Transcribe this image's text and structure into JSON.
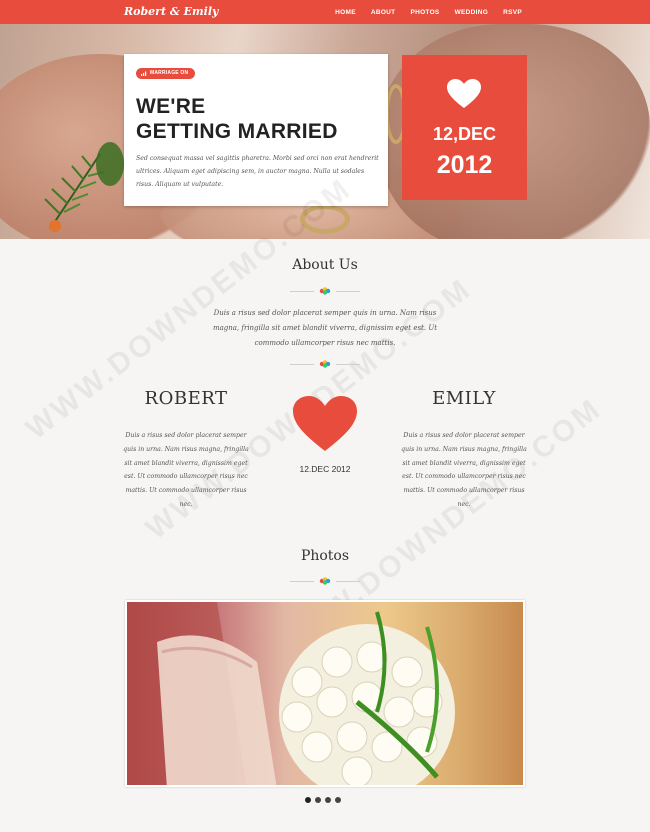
{
  "nav": {
    "brand": "Robert & Emily",
    "links": [
      "HOME",
      "ABOUT",
      "PHOTOS",
      "WEDDING",
      "RSVP"
    ]
  },
  "hero": {
    "badge": "MARRIAGE ON",
    "headline_line1": "WE'RE",
    "headline_line2": "GETTING MARRIED",
    "text": "Sed consequat massa vel sagittis pharetra. Morbi sed orci non erat hendrerit ultrices. Aliquam eget adipiscing sem, in auctor magna. Nulla ut sodales risus. Aliquam ut vulputate.",
    "date_day": "12,DEC",
    "date_year": "2012"
  },
  "about": {
    "title": "About Us",
    "text": "Duis a risus sed dolor placerat semper quis in urna. Nam risus magna, fringilla sit amet blandit viverra, dignissim eget est. Ut commodo ullamcorper risus nec mattis."
  },
  "couple": {
    "groom_name": "ROBERT",
    "groom_text": "Duis a risus sed dolor placerat semper quis in urna. Nam risus magna, fringilla sit amet blandit viverra, dignissim eget est. Ut commodo ullamcorper risus nec mattis. Ut commodo ullamcorper risus nec.",
    "bride_name": "EMILY",
    "bride_text": "Duis a risus sed dolor placerat semper quis in urna. Nam risus magna, fringilla sit amet blandit viverra, dignissim eget est. Ut commodo ullamcorper risus nec mattis. Ut commodo ullamcorper risus nec.",
    "date": "12.DEC 2012"
  },
  "photos": {
    "title": "Photos",
    "slide_count": 4,
    "active_slide": 1
  },
  "watermark": "WWW.DOWNDEMO.COM",
  "colors": {
    "accent": "#e84c3d",
    "background": "#f6f5f4"
  }
}
